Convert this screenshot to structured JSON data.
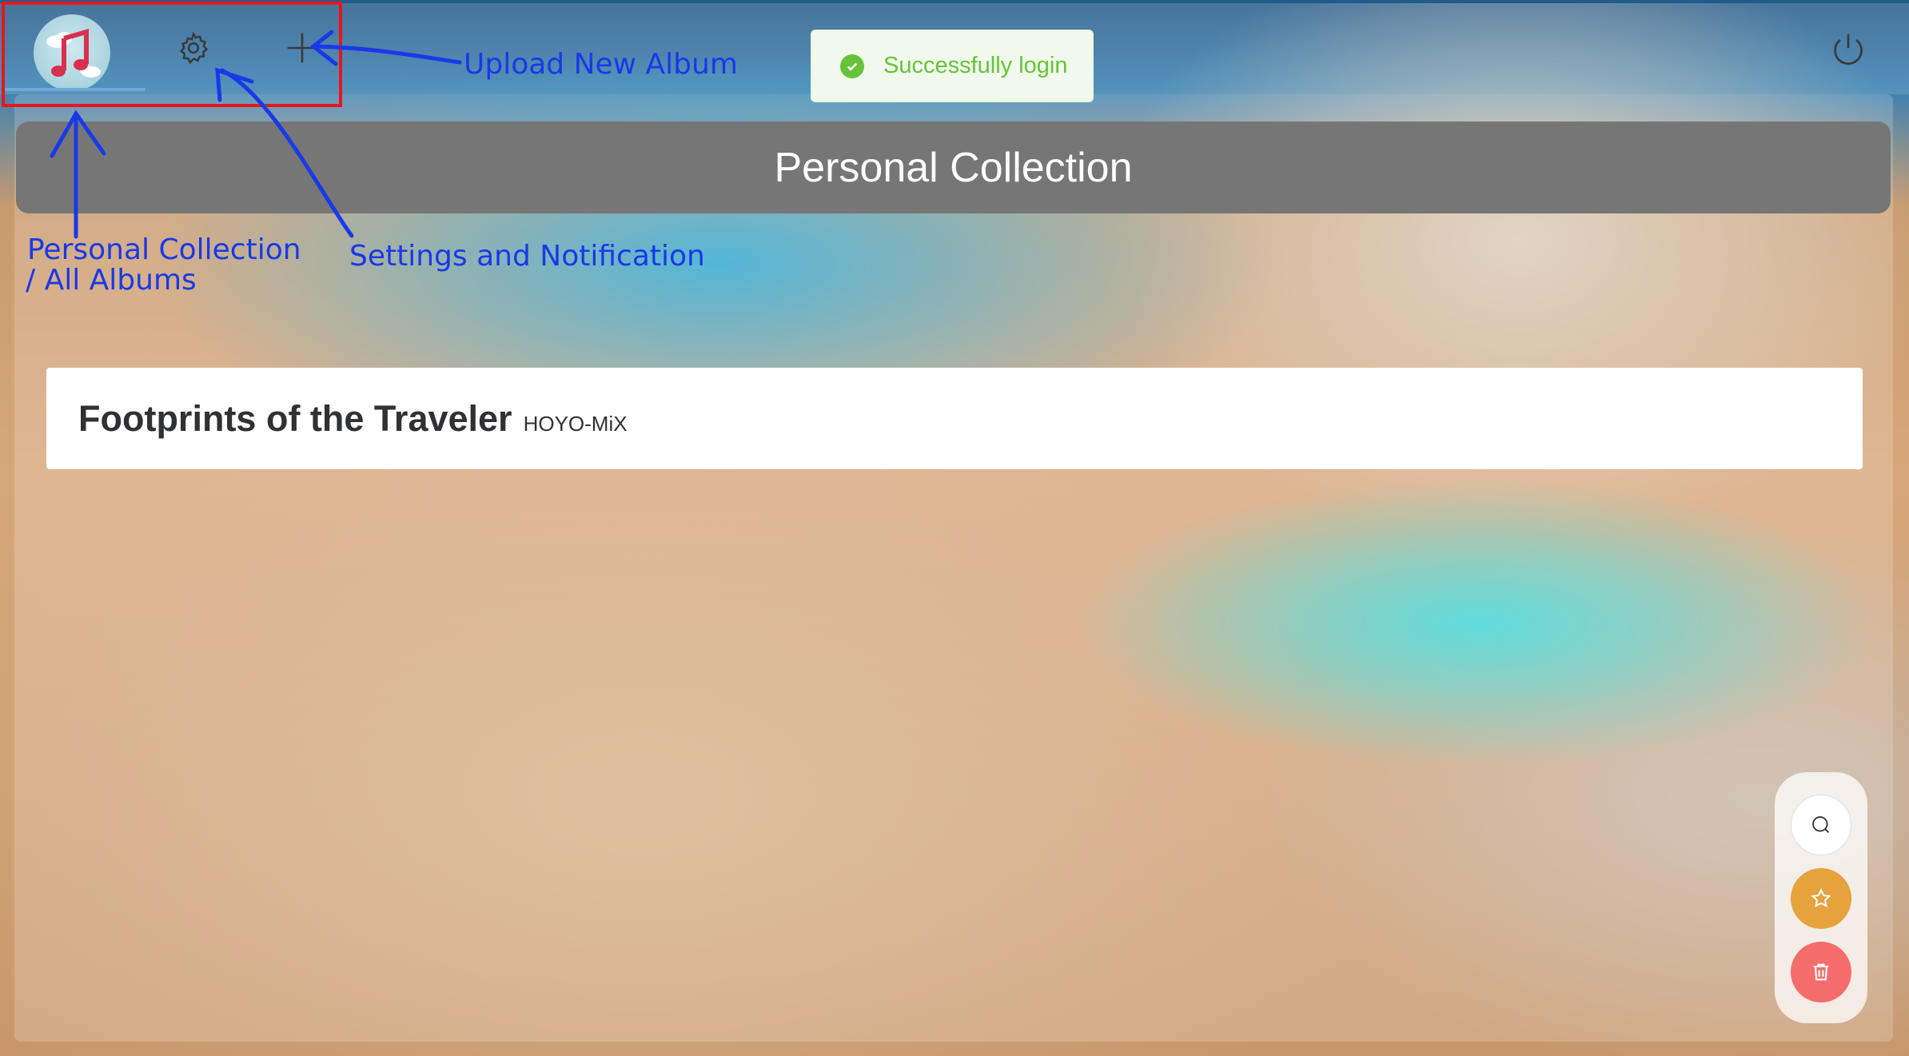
{
  "header": {
    "title": "Personal Collection"
  },
  "nav": {
    "logo_icon": "music-note-icon",
    "settings_icon": "gear-icon",
    "upload_icon": "plus-icon",
    "logout_icon": "power-icon"
  },
  "toast": {
    "message": "Successfully login",
    "icon": "check-circle-icon",
    "color": "#67c23a"
  },
  "albums": [
    {
      "title": "Footprints of the Traveler",
      "artist": "HOYO-MiX"
    }
  ],
  "fab": {
    "search_icon": "search-icon",
    "favorite_icon": "star-icon",
    "delete_icon": "trash-icon",
    "favorite_color": "#e6a23c",
    "delete_color": "#f56c6c"
  },
  "annotations": {
    "upload": "Upload New Album",
    "collection_line1": "Personal Collection",
    "collection_line2": "/ All Albums",
    "settings": "Settings and Notification",
    "color": "#1939e8"
  }
}
